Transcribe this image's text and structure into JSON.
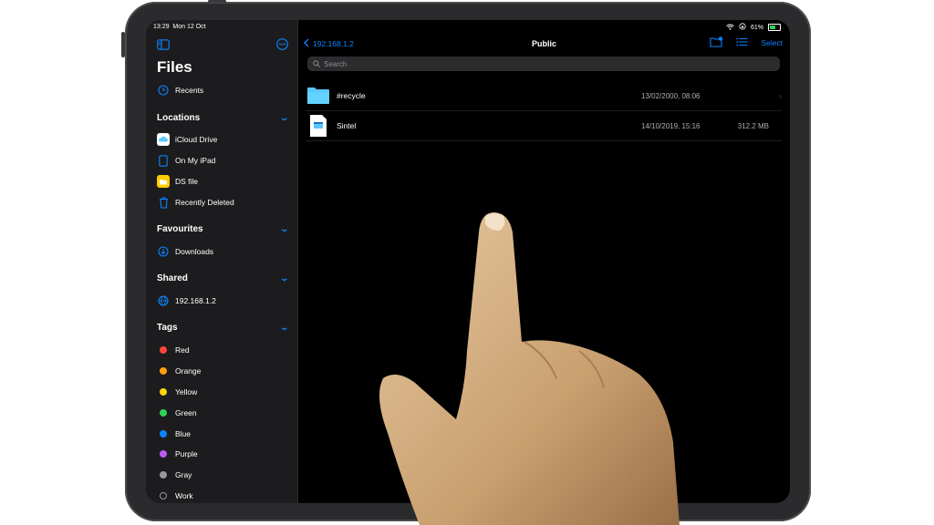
{
  "status": {
    "time": "13:29",
    "date": "Mon 12 Oct",
    "battery": "61%"
  },
  "sidebar": {
    "title": "Files",
    "recents": "Recents",
    "sections": {
      "locations": "Locations",
      "favourites": "Favourites",
      "shared": "Shared",
      "tags": "Tags"
    },
    "locations": [
      "iCloud Drive",
      "On My iPad",
      "DS file",
      "Recently Deleted"
    ],
    "favourites": [
      "Downloads"
    ],
    "shared": [
      "192.168.1.2"
    ],
    "tags": [
      {
        "label": "Red",
        "color": "#ff453a"
      },
      {
        "label": "Orange",
        "color": "#ff9f0a"
      },
      {
        "label": "Yellow",
        "color": "#ffd60a"
      },
      {
        "label": "Green",
        "color": "#30d158"
      },
      {
        "label": "Blue",
        "color": "#0a84ff"
      },
      {
        "label": "Purple",
        "color": "#bf5af2"
      },
      {
        "label": "Gray",
        "color": "#98989d"
      },
      {
        "label": "Work",
        "color": "none"
      }
    ]
  },
  "nav": {
    "back": "192.168.1.2",
    "title": "Public",
    "select": "Select"
  },
  "search": {
    "placeholder": "Search"
  },
  "files": [
    {
      "name": "#recycle",
      "date": "13/02/2000, 08:06",
      "size": "",
      "icon": "folder-icon"
    },
    {
      "name": "Sintel",
      "date": "14/10/2019, 15:16",
      "size": "312.2 MB",
      "icon": "video-file-icon"
    }
  ],
  "colors": {
    "accent": "#0a84ff",
    "sidebar_bg": "#1c1c1e",
    "main_bg": "#000000"
  }
}
